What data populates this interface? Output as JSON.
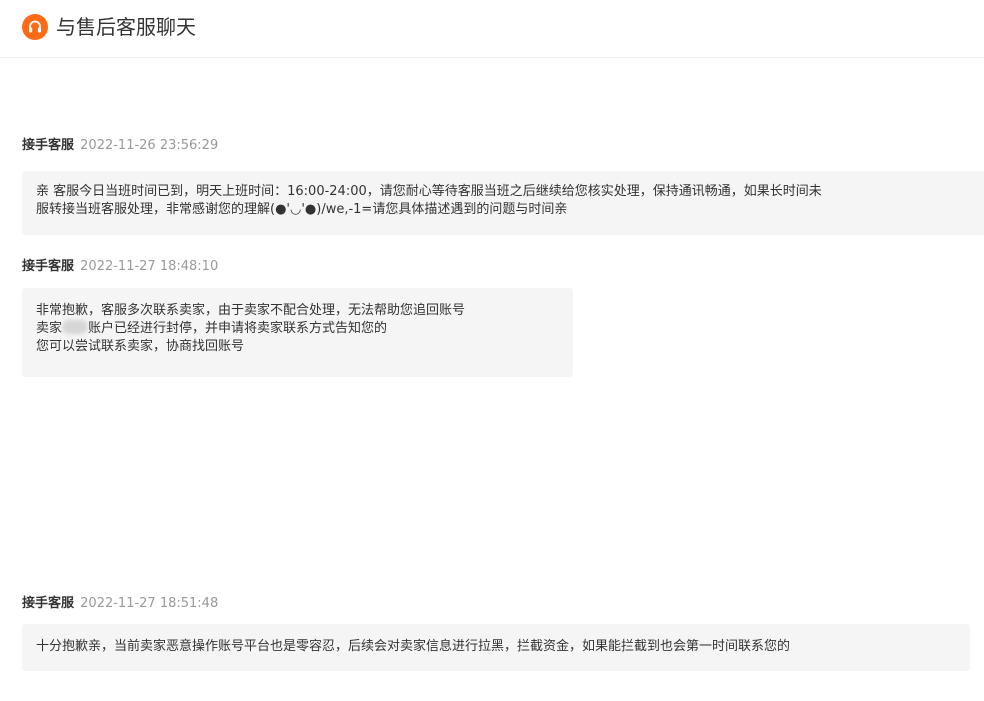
{
  "header": {
    "icon": "headset-icon",
    "accent_color": "#ff6a17",
    "title": "与售后客服聊天"
  },
  "messages": [
    {
      "sender": "接手客服",
      "time": "2022-11-26 23:56:29",
      "lines": [
        "亲 客服今日当班时间已到，明天上班时间：16:00-24:00，请您耐心等待客服当班之后继续给您核实处理，保持通讯畅通，如果长时间未",
        "服转接当班客服处理，非常感谢您的理解(●'◡'●)/we,-1=请您具体描述遇到的问题与时间亲"
      ]
    },
    {
      "sender": "接手客服",
      "time": "2022-11-27 18:48:10",
      "lines": [
        "非常抱歉，客服多次联系卖家，由于卖家不配合处理，无法帮助您追回账号",
        "卖家",
        "账户已经进行封停，并申请将卖家联系方式告知您的",
        "您可以尝试联系卖家，协商找回账号"
      ]
    },
    {
      "sender": "接手客服",
      "time": "2022-11-27 18:51:48",
      "lines": [
        "十分抱歉亲，当前卖家恶意操作账号平台也是零容忍，后续会对卖家信息进行拉黑，拦截资金，如果能拦截到也会第一时间联系您的"
      ]
    }
  ]
}
